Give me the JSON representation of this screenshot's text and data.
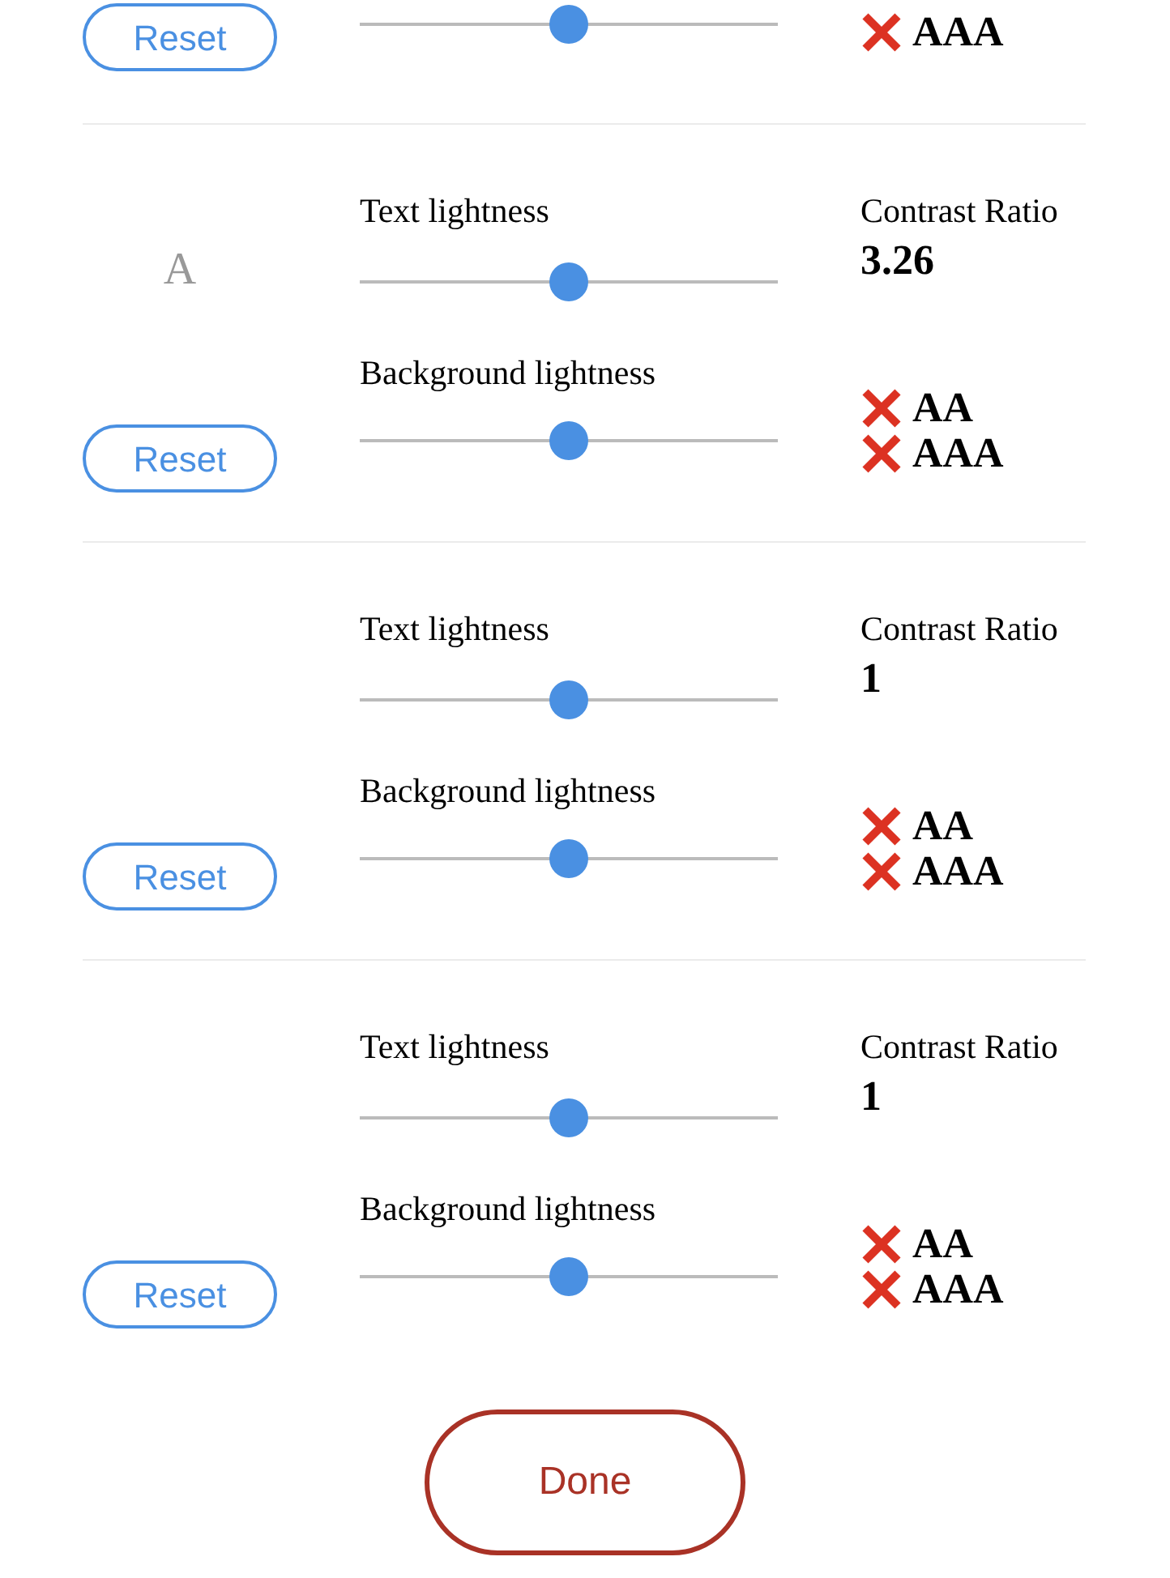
{
  "partial_row": {
    "bg_slider": {
      "level": 0.5
    },
    "checks": [
      {
        "label": "AAA",
        "passed": false
      }
    ],
    "reset": "Reset"
  },
  "rows": [
    {
      "sample": "A",
      "text_label": "Text lightness",
      "text_slider": {
        "level": 0.5
      },
      "bg_label": "Background lightness",
      "bg_slider": {
        "level": 0.5
      },
      "contrast_label": "Contrast Ratio",
      "ratio": "3.26",
      "checks": [
        {
          "label": "AA",
          "passed": false
        },
        {
          "label": "AAA",
          "passed": false
        }
      ],
      "reset": "Reset"
    },
    {
      "text_label": "Text lightness",
      "text_slider": {
        "level": 0.5
      },
      "bg_label": "Background lightness",
      "bg_slider": {
        "level": 0.5
      },
      "contrast_label": "Contrast Ratio",
      "ratio": "1",
      "checks": [
        {
          "label": "AA",
          "passed": false
        },
        {
          "label": "AAA",
          "passed": false
        }
      ],
      "reset": "Reset"
    },
    {
      "text_label": "Text lightness",
      "text_slider": {
        "level": 0.5
      },
      "bg_label": "Background lightness",
      "bg_slider": {
        "level": 0.5
      },
      "contrast_label": "Contrast Ratio",
      "ratio": "1",
      "checks": [
        {
          "label": "AA",
          "passed": false
        },
        {
          "label": "AAA",
          "passed": false
        }
      ],
      "reset": "Reset"
    }
  ],
  "done": "Done"
}
